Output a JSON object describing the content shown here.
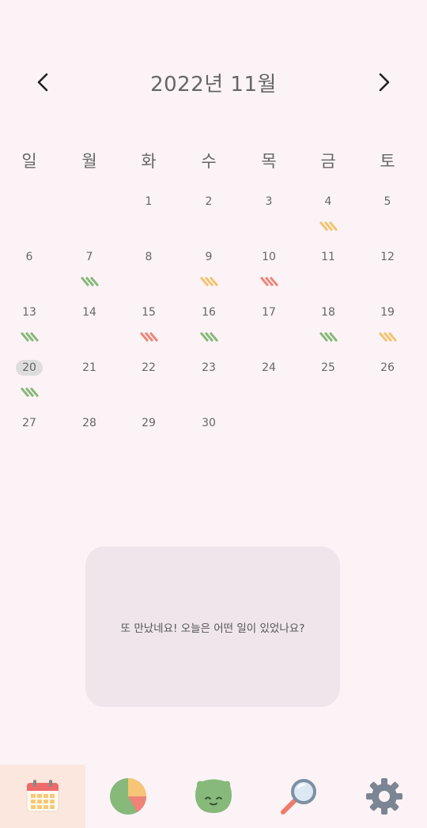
{
  "header": {
    "title": "2022년 11월",
    "prev_icon": "chevron-left-icon",
    "next_icon": "chevron-right-icon"
  },
  "weekdays": [
    "일",
    "월",
    "화",
    "수",
    "목",
    "금",
    "토"
  ],
  "calendar": {
    "today": "20",
    "weeks": [
      [
        null,
        null,
        {
          "day": "1"
        },
        {
          "day": "2"
        },
        {
          "day": "3"
        },
        {
          "day": "4",
          "mood": "yellow"
        },
        {
          "day": "5"
        }
      ],
      [
        {
          "day": "6"
        },
        {
          "day": "7",
          "mood": "green"
        },
        {
          "day": "8"
        },
        {
          "day": "9",
          "mood": "yellow"
        },
        {
          "day": "10",
          "mood": "red"
        },
        {
          "day": "11"
        },
        {
          "day": "12"
        }
      ],
      [
        {
          "day": "13",
          "mood": "green"
        },
        {
          "day": "14"
        },
        {
          "day": "15",
          "mood": "red"
        },
        {
          "day": "16",
          "mood": "green"
        },
        {
          "day": "17"
        },
        {
          "day": "18",
          "mood": "green"
        },
        {
          "day": "19",
          "mood": "yellow"
        }
      ],
      [
        {
          "day": "20",
          "mood": "green"
        },
        {
          "day": "21"
        },
        {
          "day": "22"
        },
        {
          "day": "23"
        },
        {
          "day": "24"
        },
        {
          "day": "25"
        },
        {
          "day": "26"
        }
      ],
      [
        {
          "day": "27"
        },
        {
          "day": "28"
        },
        {
          "day": "29"
        },
        {
          "day": "30"
        },
        null,
        null,
        null
      ]
    ]
  },
  "mood_colors": {
    "green": "#85b878",
    "yellow": "#f3c36e",
    "red": "#ee8577"
  },
  "message": "또 만났네요! 오늘은 어떤 일이 있었나요?",
  "tabs": [
    {
      "icon": "calendar-icon",
      "active": true
    },
    {
      "icon": "pie-chart-icon",
      "active": false
    },
    {
      "icon": "face-icon",
      "active": false
    },
    {
      "icon": "search-icon",
      "active": false
    },
    {
      "icon": "gear-icon",
      "active": false
    }
  ],
  "colors": {
    "background": "#fcf3f6",
    "card": "#efe6ec",
    "active_tab": "#fbe7de"
  }
}
